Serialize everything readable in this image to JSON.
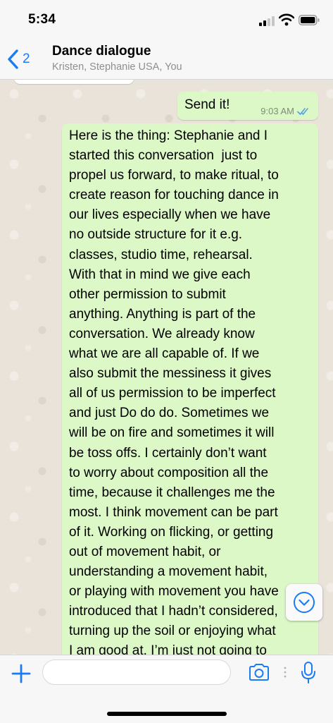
{
  "status_bar": {
    "time": "5:34"
  },
  "header": {
    "back_count": "2",
    "title": "Dance dialogue",
    "subtitle": "Kristen, Stephanie USA, You"
  },
  "messages": [
    {
      "text": "Send it!",
      "time": "9:03 AM",
      "status": "read"
    },
    {
      "text": "Here is the thing: Stephanie and I\nstarted this conversation  just to\npropel us forward, to make ritual, to\ncreate reason for touching dance in\nour lives especially when we have\nno outside structure for it e.g.\nclasses, studio time, rehearsal.\nWith that in mind we give each\nother permission to submit\nanything. Anything is part of the\nconversation. We already know\nwhat we are all capable of. If we\nalso submit the messiness it gives\nall of us permission to be imperfect\nand just Do do do. Sometimes we\nwill be on fire and sometimes it will\nbe toss offs. I certainly don’t want\nto worry about composition all the\ntime, because it challenges me the\nmost. I think movement can be part\nof it. Working on flicking, or getting\nout of movement habit, or\nunderstanding a movement habit,\nor playing with movement you have\nintroduced that I hadn’t considered,\nturning up the soil or enjoying what\nI am good at. I’m just not going to"
    }
  ],
  "input": {
    "placeholder": ""
  },
  "colors": {
    "accent": "#1a7cf2",
    "outgoing_bubble": "#dcf8c6",
    "chat_background": "#e9e3d9",
    "read_ticks": "#4fa3e0"
  },
  "icons": [
    "back-chevron-icon",
    "read-ticks-icon",
    "chevron-down-circle-icon",
    "plus-icon",
    "camera-icon",
    "microphone-icon",
    "wifi-icon",
    "battery-icon",
    "signal-icon"
  ]
}
